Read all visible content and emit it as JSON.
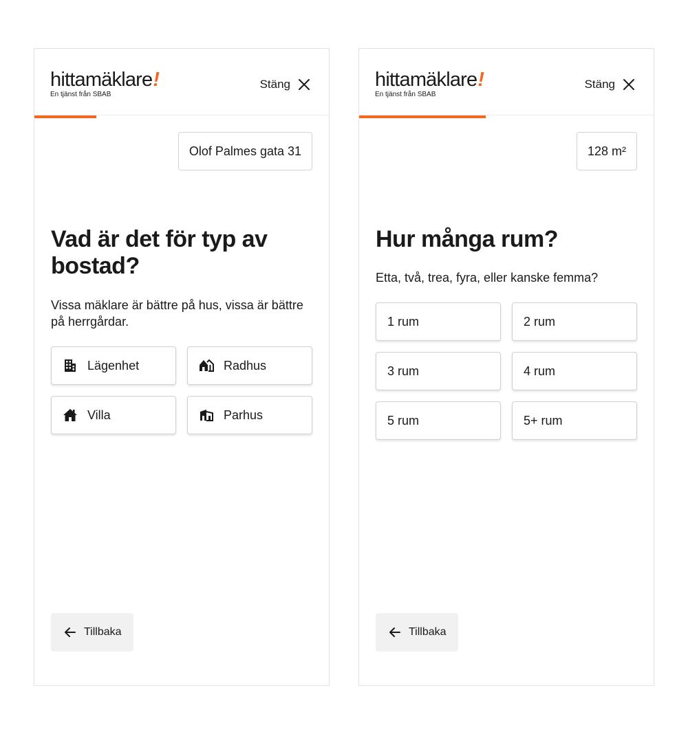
{
  "brand": {
    "logo_text": "hittamäklare",
    "logo_mark": "!",
    "tagline": "En tjänst från SBAB",
    "accent_color": "#f26722"
  },
  "steps": [
    {
      "close_label": "Stäng",
      "progress": 0.21,
      "answer_chip": "Olof Palmes gata 31",
      "question": "Vad är det för typ av bostad?",
      "subtitle": "Vissa mäklare är bättre på hus, vissa är bättre på herrgårdar.",
      "options": [
        {
          "label": "Lägenhet",
          "icon": "apartment-icon"
        },
        {
          "label": "Radhus",
          "icon": "townhouse-icon"
        },
        {
          "label": "Villa",
          "icon": "villa-icon"
        },
        {
          "label": "Parhus",
          "icon": "semi-detached-icon"
        }
      ],
      "back_label": "Tillbaka"
    },
    {
      "close_label": "Stäng",
      "progress": 0.43,
      "answer_chip": "128 m²",
      "question": "Hur många rum?",
      "subtitle": "Etta, två, trea, fyra, eller kanske femma?",
      "options": [
        {
          "label": "1 rum"
        },
        {
          "label": "2 rum"
        },
        {
          "label": "3 rum"
        },
        {
          "label": "4 rum"
        },
        {
          "label": "5 rum"
        },
        {
          "label": "5+ rum"
        }
      ],
      "back_label": "Tillbaka"
    }
  ]
}
